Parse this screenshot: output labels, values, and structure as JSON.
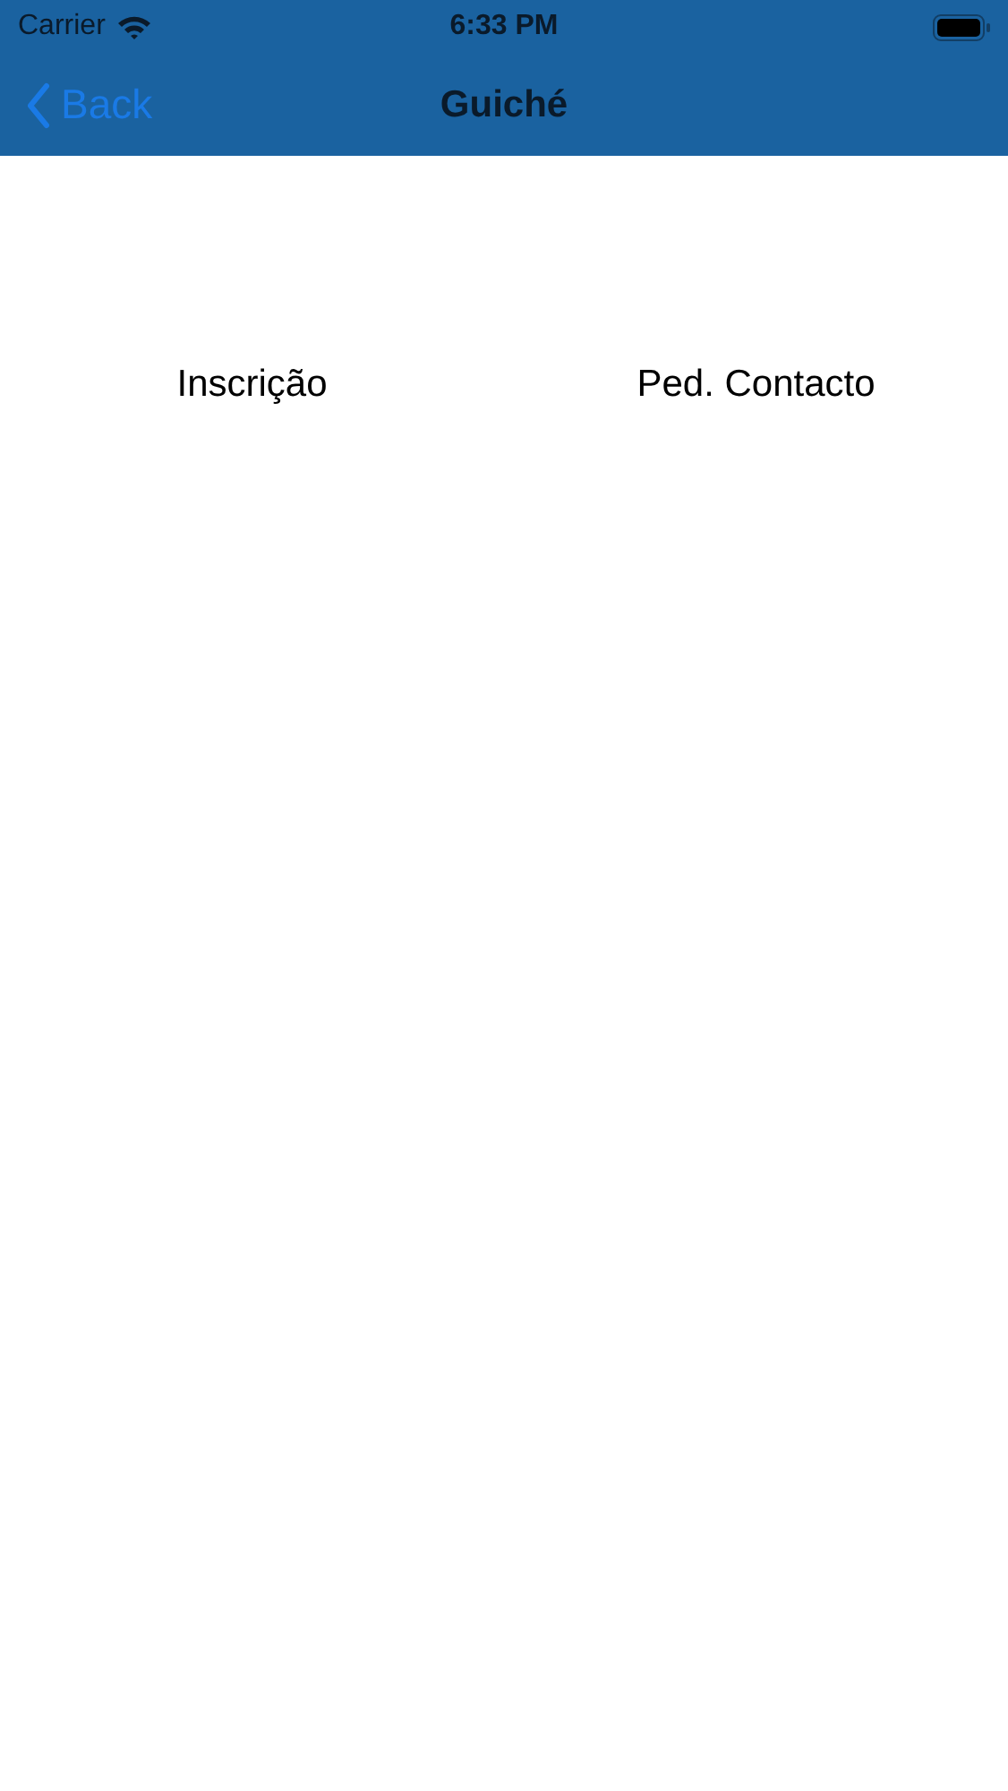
{
  "status_bar": {
    "carrier": "Carrier",
    "time": "6:33 PM"
  },
  "nav_bar": {
    "back": "Back",
    "title": "Guiché"
  },
  "options": [
    {
      "label": "Inscrição"
    },
    {
      "label": "Ped. Contacto"
    }
  ]
}
